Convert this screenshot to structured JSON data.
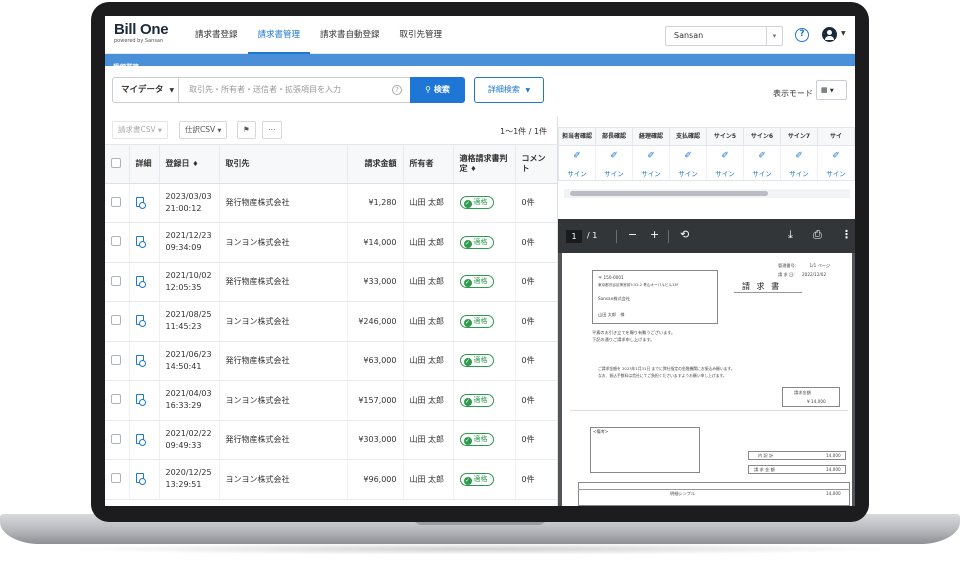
{
  "header": {
    "logo_main": "Bill One",
    "logo_sub": "powered by Sansan",
    "nav": [
      "請求書登録",
      "請求書管理",
      "請求書自動登録",
      "取引先管理"
    ],
    "nav_active_index": 1,
    "org_select": "Sansan",
    "subbar_label": "受領業務"
  },
  "search": {
    "scope_label": "マイデータ",
    "placeholder": "取引先・所有者・送信者・拡張項目を入力",
    "search_button": "検索",
    "advanced_button": "詳細検索",
    "view_mode_label": "表示モード"
  },
  "toolbar": {
    "invoice_csv": "請求書CSV",
    "journal_csv": "仕訳CSV",
    "count_text": "1〜1件 / 1件"
  },
  "table": {
    "columns": [
      "詳細",
      "登録日",
      "取引先",
      "請求金額",
      "所有者",
      "適格請求書判定",
      "コメント"
    ],
    "rows": [
      {
        "date": "2023/03/03",
        "time": "21:00:12",
        "partner": "発行物産株式会社",
        "amount": "¥1,280",
        "owner": "山田 太郎",
        "status": "適格",
        "comment": "0件"
      },
      {
        "date": "2021/12/23",
        "time": "09:34:09",
        "partner": "ヨンヨン株式会社",
        "amount": "¥14,000",
        "owner": "山田 太郎",
        "status": "適格",
        "comment": "0件"
      },
      {
        "date": "2021/10/02",
        "time": "12:05:35",
        "partner": "発行物産株式会社",
        "amount": "¥33,000",
        "owner": "山田 太郎",
        "status": "適格",
        "comment": "0件"
      },
      {
        "date": "2021/08/25",
        "time": "11:45:23",
        "partner": "ヨンヨン株式会社",
        "amount": "¥246,000",
        "owner": "山田 太郎",
        "status": "適格",
        "comment": "0件"
      },
      {
        "date": "2021/06/23",
        "time": "14:50:41",
        "partner": "発行物産株式会社",
        "amount": "¥63,000",
        "owner": "山田 太郎",
        "status": "適格",
        "comment": "0件"
      },
      {
        "date": "2021/04/03",
        "time": "16:33:29",
        "partner": "ヨンヨン株式会社",
        "amount": "¥157,000",
        "owner": "山田 太郎",
        "status": "適格",
        "comment": "0件"
      },
      {
        "date": "2021/02/22",
        "time": "09:49:33",
        "partner": "発行物産株式会社",
        "amount": "¥303,000",
        "owner": "山田 太郎",
        "status": "適格",
        "comment": "0件"
      },
      {
        "date": "2020/12/25",
        "time": "13:29:51",
        "partner": "ヨンヨン株式会社",
        "amount": "¥96,000",
        "owner": "山田 太郎",
        "status": "適格",
        "comment": "0件"
      }
    ]
  },
  "approvals": {
    "columns": [
      "担当者確認",
      "部長確認",
      "経理確認",
      "支払確認",
      "サイン5",
      "サイン6",
      "サイン7",
      "サイ"
    ],
    "cell_label": "サイン"
  },
  "pdf": {
    "page_current": "1",
    "page_total": "/ 1",
    "doc": {
      "title": "請 求 書",
      "invoice_no": "管理番号:",
      "page_info": "1/1 ページ",
      "issue_label": "請 求 日:",
      "issue_date": "2022/12/02",
      "postal": "〒 150-0001",
      "address": "東京都渋谷区神宮前5-52-2 青山オーバルビル13F",
      "company": "Sansan株式会社",
      "person": "山田 太郎　様",
      "greeting1": "平素のお引き立てを賜り有難うございます。",
      "greeting2": "下記の通りご請求申し上げます。",
      "note1": "ご請求金額を 2023年1月31日 までに弊社指定の金融機関にお振込み願います。",
      "note2": "なお、振込手数料は貴社にてご負担くださいますようお願い申し上げます。",
      "total_label": "請求金額",
      "total_value": "¥ 14,000",
      "remarks": "<備考>",
      "subtotal_label": "内 訳 計",
      "subtotal_value": "14,000",
      "amount_label": "請 求 金 額",
      "amount_value": "14,000",
      "line_item": "明細シンプル",
      "line_item_amount": "14,000"
    }
  },
  "colors": {
    "accent": "#1e77d4",
    "ok": "#2e9a4e",
    "pdf_toolbar": "#323639",
    "subbar": "#4a90d9"
  }
}
